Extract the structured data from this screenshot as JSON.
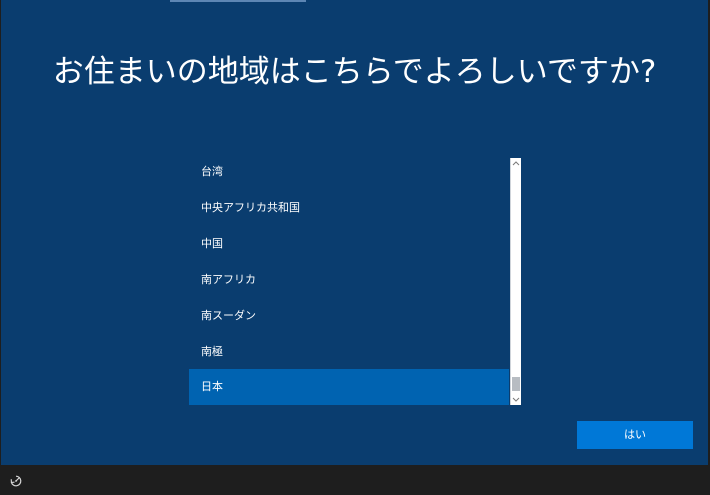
{
  "page": {
    "title": "お住まいの地域はこちらでよろしいですか?"
  },
  "region_list": {
    "items": [
      {
        "label": "台湾",
        "selected": false
      },
      {
        "label": "中央アフリカ共和国",
        "selected": false
      },
      {
        "label": "中国",
        "selected": false
      },
      {
        "label": "南アフリカ",
        "selected": false
      },
      {
        "label": "南スーダン",
        "selected": false
      },
      {
        "label": "南極",
        "selected": false
      },
      {
        "label": "日本",
        "selected": true
      }
    ],
    "scroll_up_icon": "chevron-up-icon",
    "scroll_down_icon": "chevron-down-icon"
  },
  "actions": {
    "yes_label": "はい"
  },
  "taskbar": {
    "icon": "accessibility-icon"
  },
  "colors": {
    "background": "#0a3d6f",
    "selected_item": "#0063b1",
    "button": "#0078d7",
    "bottom_bar": "#1e1e1e",
    "text": "#ffffff"
  }
}
